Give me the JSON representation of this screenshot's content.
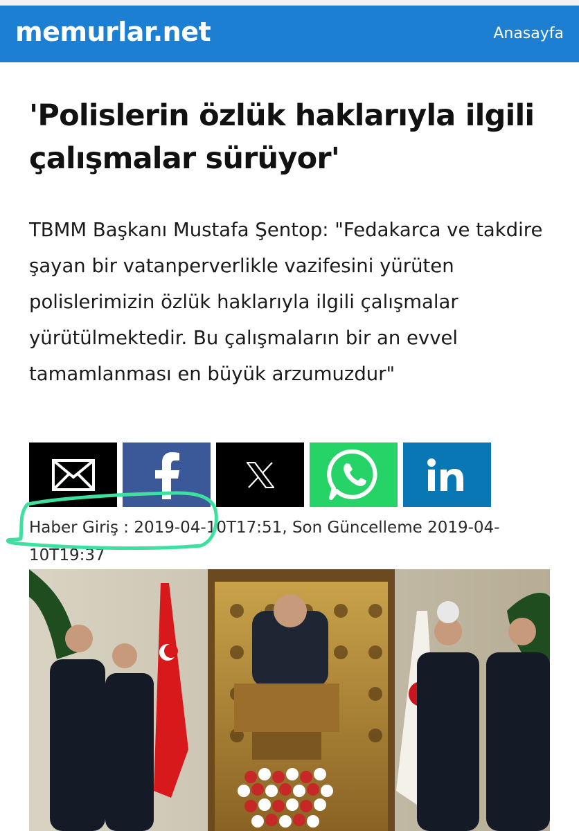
{
  "header": {
    "logo_text": "memurlar.net",
    "nav_home_label": "Anasayfa",
    "brand_color": "#1d7fd1"
  },
  "article": {
    "title": "'Polislerin özlük haklarıyla ilgili çalışmalar sürüyor'",
    "summary": "TBMM Başkanı Mustafa Şentop: \"Fedakarca ve takdire şayan bir vatanperverlikle vazifesini yürüten polislerimizin özlük haklarıyla ilgili çalışmalar yürütülmektedir. Bu çalışmaların bir an evvel tamamlanması en büyük arzumuzdur\"",
    "meta": "Haber Giriş : 2019-04-10T17:51, Son Güncelleme 2019-04-10T19:37"
  },
  "share_buttons": [
    {
      "icon": "email-icon",
      "color": "#000000"
    },
    {
      "icon": "facebook-icon",
      "color": "#3b5998"
    },
    {
      "icon": "x-icon",
      "color": "#000000"
    },
    {
      "icon": "whatsapp-icon",
      "color": "#25d366"
    },
    {
      "icon": "linkedin-icon",
      "color": "#0a77b5"
    }
  ],
  "annotation": {
    "color": "#3ee0a0"
  }
}
